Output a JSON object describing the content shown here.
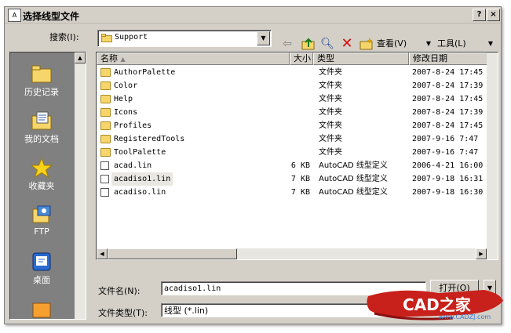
{
  "window": {
    "title": "选择线型文件",
    "help_label": "?",
    "close_label": "×"
  },
  "lookin": {
    "label": "搜索(I):",
    "value": "Support"
  },
  "toolbar": {
    "view_label": "查看(V)",
    "tools_label": "工具(L)"
  },
  "places": [
    {
      "label": "历史记录",
      "icon": "history-folder-icon"
    },
    {
      "label": "我的文档",
      "icon": "my-documents-icon"
    },
    {
      "label": "收藏夹",
      "icon": "favorites-star-icon"
    },
    {
      "label": "FTP",
      "icon": "ftp-icon"
    },
    {
      "label": "桌面",
      "icon": "desktop-icon"
    }
  ],
  "columns": {
    "name": "名称",
    "size": "大小",
    "type": "类型",
    "modified": "修改日期"
  },
  "files": [
    {
      "name": "AuthorPalette",
      "size": "",
      "type": "文件夹",
      "date": "2007-8-24 17:45",
      "kind": "folder"
    },
    {
      "name": "Color",
      "size": "",
      "type": "文件夹",
      "date": "2007-8-24 17:39",
      "kind": "folder"
    },
    {
      "name": "Help",
      "size": "",
      "type": "文件夹",
      "date": "2007-8-24 17:45",
      "kind": "folder"
    },
    {
      "name": "Icons",
      "size": "",
      "type": "文件夹",
      "date": "2007-8-24 17:39",
      "kind": "folder"
    },
    {
      "name": "Profiles",
      "size": "",
      "type": "文件夹",
      "date": "2007-8-24 17:45",
      "kind": "folder"
    },
    {
      "name": "RegisteredTools",
      "size": "",
      "type": "文件夹",
      "date": "2007-9-16 7:47",
      "kind": "folder"
    },
    {
      "name": "ToolPalette",
      "size": "",
      "type": "文件夹",
      "date": "2007-9-16 7:47",
      "kind": "folder"
    },
    {
      "name": "acad.lin",
      "size": "6 KB",
      "type": "AutoCAD 线型定义",
      "date": "2006-4-21 16:00",
      "kind": "file"
    },
    {
      "name": "acadiso1.lin",
      "size": "7 KB",
      "type": "AutoCAD 线型定义",
      "date": "2007-9-18 16:31",
      "kind": "file"
    },
    {
      "name": "acadiso.lin",
      "size": "7 KB",
      "type": "AutoCAD 线型定义",
      "date": "2007-9-18 16:30",
      "kind": "file"
    }
  ],
  "filename": {
    "label": "文件名(N):",
    "value": "acadiso1.lin"
  },
  "filetype": {
    "label": "文件类型(T):",
    "value": "线型 (*.lin)"
  },
  "open_button": "打开(O)",
  "watermark": {
    "text": "CAD之家",
    "url": "www.CADZJ.com"
  },
  "colors": {
    "dialog_bg": "#d4d0c8",
    "places_bg": "#808080",
    "selected_row": "#e9e7e1",
    "watermark_red": "#c8201a"
  }
}
